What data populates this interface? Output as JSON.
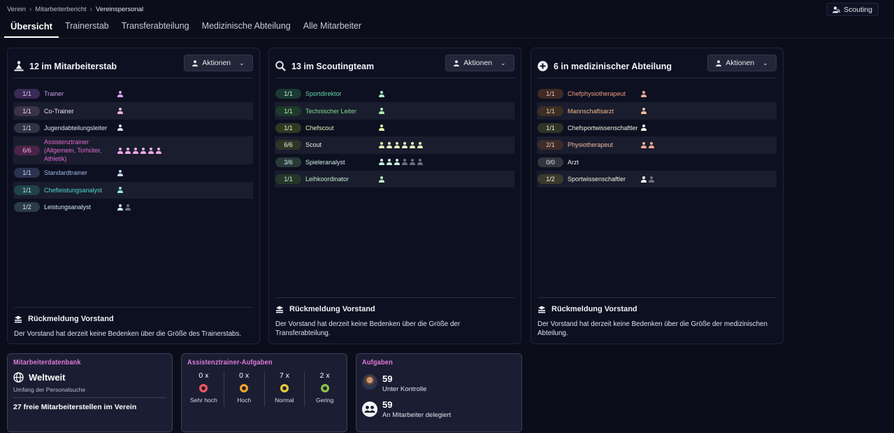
{
  "breadcrumb": [
    "Verein",
    "Mitarbeiterbericht",
    "Vereinspersonal"
  ],
  "scouting_button": "Scouting",
  "tabs": [
    "Übersicht",
    "Trainerstab",
    "Transferabteilung",
    "Medizinische Abteilung",
    "Alle Mitarbeiter"
  ],
  "actions_label": "Aktionen",
  "panels": [
    {
      "title": "12 im Mitarbeiterstab",
      "icon": "coach-icon",
      "rows": [
        {
          "badge": "1/1",
          "role": "Trainer",
          "badge_bg": "#3a2a55",
          "badge_fg": "#d6c4f7",
          "role_color": "#c79df0",
          "filled": 1,
          "empty": 0,
          "person_color": "#d6a6f2"
        },
        {
          "badge": "1/1",
          "role": "Co-Trainer",
          "badge_bg": "#3b3446",
          "badge_fg": "#f0d8f0",
          "role_color": "#eee0ee",
          "filled": 1,
          "empty": 0,
          "person_color": "#f0b8e8"
        },
        {
          "badge": "1/1",
          "role": "Jugendabteilungsleiter",
          "badge_bg": "#2e3346",
          "badge_fg": "#d8dce8",
          "role_color": "#dde2ec",
          "filled": 1,
          "empty": 0,
          "person_color": "#dde2f0"
        },
        {
          "badge": "6/6",
          "role": "Assistenztrainer (Allgemein, Torhüter, Athletik)",
          "badge_bg": "#4a2446",
          "badge_fg": "#f2a9e4",
          "role_color": "#e16ad0",
          "filled": 6,
          "empty": 0,
          "person_color": "#f2a9e8"
        },
        {
          "badge": "1/1",
          "role": "Standardtrainer",
          "badge_bg": "#2b3350",
          "badge_fg": "#cfd8f2",
          "role_color": "#9fb4ec",
          "filled": 1,
          "empty": 0,
          "person_color": "#c6d8f8"
        },
        {
          "badge": "1/1",
          "role": "Chefleistungsanalyst",
          "badge_bg": "#1f4347",
          "badge_fg": "#b4ecec",
          "role_color": "#4ed8d0",
          "filled": 1,
          "empty": 0,
          "person_color": "#8ee8e2"
        },
        {
          "badge": "1/2",
          "role": "Leistungsanalyst",
          "badge_bg": "#2a3a48",
          "badge_fg": "#d0e8f2",
          "role_color": "#cfe9f2",
          "filled": 1,
          "empty": 1,
          "person_color": "#cfeaf2"
        }
      ],
      "feedback_title": "Rückmeldung Vorstand",
      "feedback_text": "Der Vorstand hat derzeit keine Bedenken über die Größe des Trainerstabs."
    },
    {
      "title": "13 im Scoutingteam",
      "icon": "search-icon",
      "rows": [
        {
          "badge": "1/1",
          "role": "Sportdirektor",
          "badge_bg": "#1b3a33",
          "badge_fg": "#b8ecd8",
          "role_color": "#67d6a6",
          "filled": 1,
          "empty": 0,
          "person_color": "#a8ecc8"
        },
        {
          "badge": "1/1",
          "role": "Technischer Leiter",
          "badge_bg": "#1d3a2a",
          "badge_fg": "#bfecc4",
          "role_color": "#7fde88",
          "filled": 1,
          "empty": 0,
          "person_color": "#b0ecb4"
        },
        {
          "badge": "1/1",
          "role": "Chefscout",
          "badge_bg": "#2c3a24",
          "badge_fg": "#e2f2c0",
          "role_color": "#e6f2b4",
          "filled": 1,
          "empty": 0,
          "person_color": "#e8f4a8"
        },
        {
          "badge": "6/6",
          "role": "Scout",
          "badge_bg": "#2f3426",
          "badge_fg": "#eef2d8",
          "role_color": "#eff2dc",
          "filled": 6,
          "empty": 0,
          "person_color": "#e8f0b8"
        },
        {
          "badge": "3/6",
          "role": "Spieleranalyst",
          "badge_bg": "#273a38",
          "badge_fg": "#d2ecec",
          "role_color": "#d6efe8",
          "filled": 3,
          "empty": 3,
          "person_color": "#c8ecd8"
        },
        {
          "badge": "1/1",
          "role": "Leihkoordinator",
          "badge_bg": "#253629",
          "badge_fg": "#c9ecc9",
          "role_color": "#c2eccc",
          "filled": 1,
          "empty": 0,
          "person_color": "#b8ecc4"
        }
      ],
      "feedback_title": "Rückmeldung Vorstand",
      "feedback_text": "Der Vorstand hat derzeit keine Bedenken über die Größe der Transferabteilung."
    },
    {
      "title": "6 in medizinischer Abteilung",
      "icon": "medical-plus-icon",
      "rows": [
        {
          "badge": "1/1",
          "role": "Chefphysiotherapeut",
          "badge_bg": "#3e2a26",
          "badge_fg": "#f2c6b8",
          "role_color": "#f09a80",
          "filled": 1,
          "empty": 0,
          "person_color": "#f0a890"
        },
        {
          "badge": "1/1",
          "role": "Mannschaftsarzt",
          "badge_bg": "#3c2e24",
          "badge_fg": "#f2d0b0",
          "role_color": "#f0b888",
          "filled": 1,
          "empty": 0,
          "person_color": "#f0c098"
        },
        {
          "badge": "1/1",
          "role": "Chefsportwissenschaftler",
          "badge_bg": "#2f3426",
          "badge_fg": "#eef0e0",
          "role_color": "#f0f2e6",
          "filled": 1,
          "empty": 0,
          "person_color": "#f4f2e8"
        },
        {
          "badge": "2/1",
          "role": "Physiotherapeut",
          "badge_bg": "#3e2c28",
          "badge_fg": "#f2c8b8",
          "role_color": "#f2b8a4",
          "filled": 2,
          "empty": 0,
          "person_color": "#f2a890"
        },
        {
          "badge": "0/0",
          "role": "Arzt",
          "badge_bg": "#34363e",
          "badge_fg": "#e8e8ee",
          "role_color": "#eceef2",
          "filled": 0,
          "empty": 0,
          "person_color": "#e8e8ee"
        },
        {
          "badge": "1/2",
          "role": "Sportwissenschaftler",
          "badge_bg": "#3a3a2c",
          "badge_fg": "#f2f0d8",
          "role_color": "#f4f2e0",
          "filled": 1,
          "empty": 1,
          "person_color": "#f4f2e4"
        }
      ],
      "feedback_title": "Rückmeldung Vorstand",
      "feedback_text": "Der Vorstand hat derzeit keine Bedenken über die Größe der medizinischen Abteilung."
    }
  ],
  "database_card": {
    "title": "Mitarbeiterdatenbank",
    "value": "Weltweit",
    "subtitle": "Umfang der Personalsuche",
    "free_positions": "27 freie Mitarbeiterstellen im Verein"
  },
  "assistant_tasks_card": {
    "title": "Assistenztrainer-Aufgaben",
    "items": [
      {
        "count": "0 x",
        "label": "Sehr hoch",
        "color": "#f2555a"
      },
      {
        "count": "0 x",
        "label": "Hoch",
        "color": "#f2a22c"
      },
      {
        "count": "7 x",
        "label": "Normal",
        "color": "#e8c83a"
      },
      {
        "count": "2 x",
        "label": "Gering",
        "color": "#8ec04a"
      }
    ]
  },
  "tasks_card": {
    "title": "Aufgaben",
    "controlled_count": "59",
    "controlled_label": "Unter Kontrolle",
    "delegated_count": "59",
    "delegated_label": "An Mitarbeiter delegiert"
  },
  "colors": {
    "background": "#0b0d1a",
    "panel": "#0d1020",
    "card": "#1b1e32",
    "accent_pink": "#e07ad8"
  }
}
